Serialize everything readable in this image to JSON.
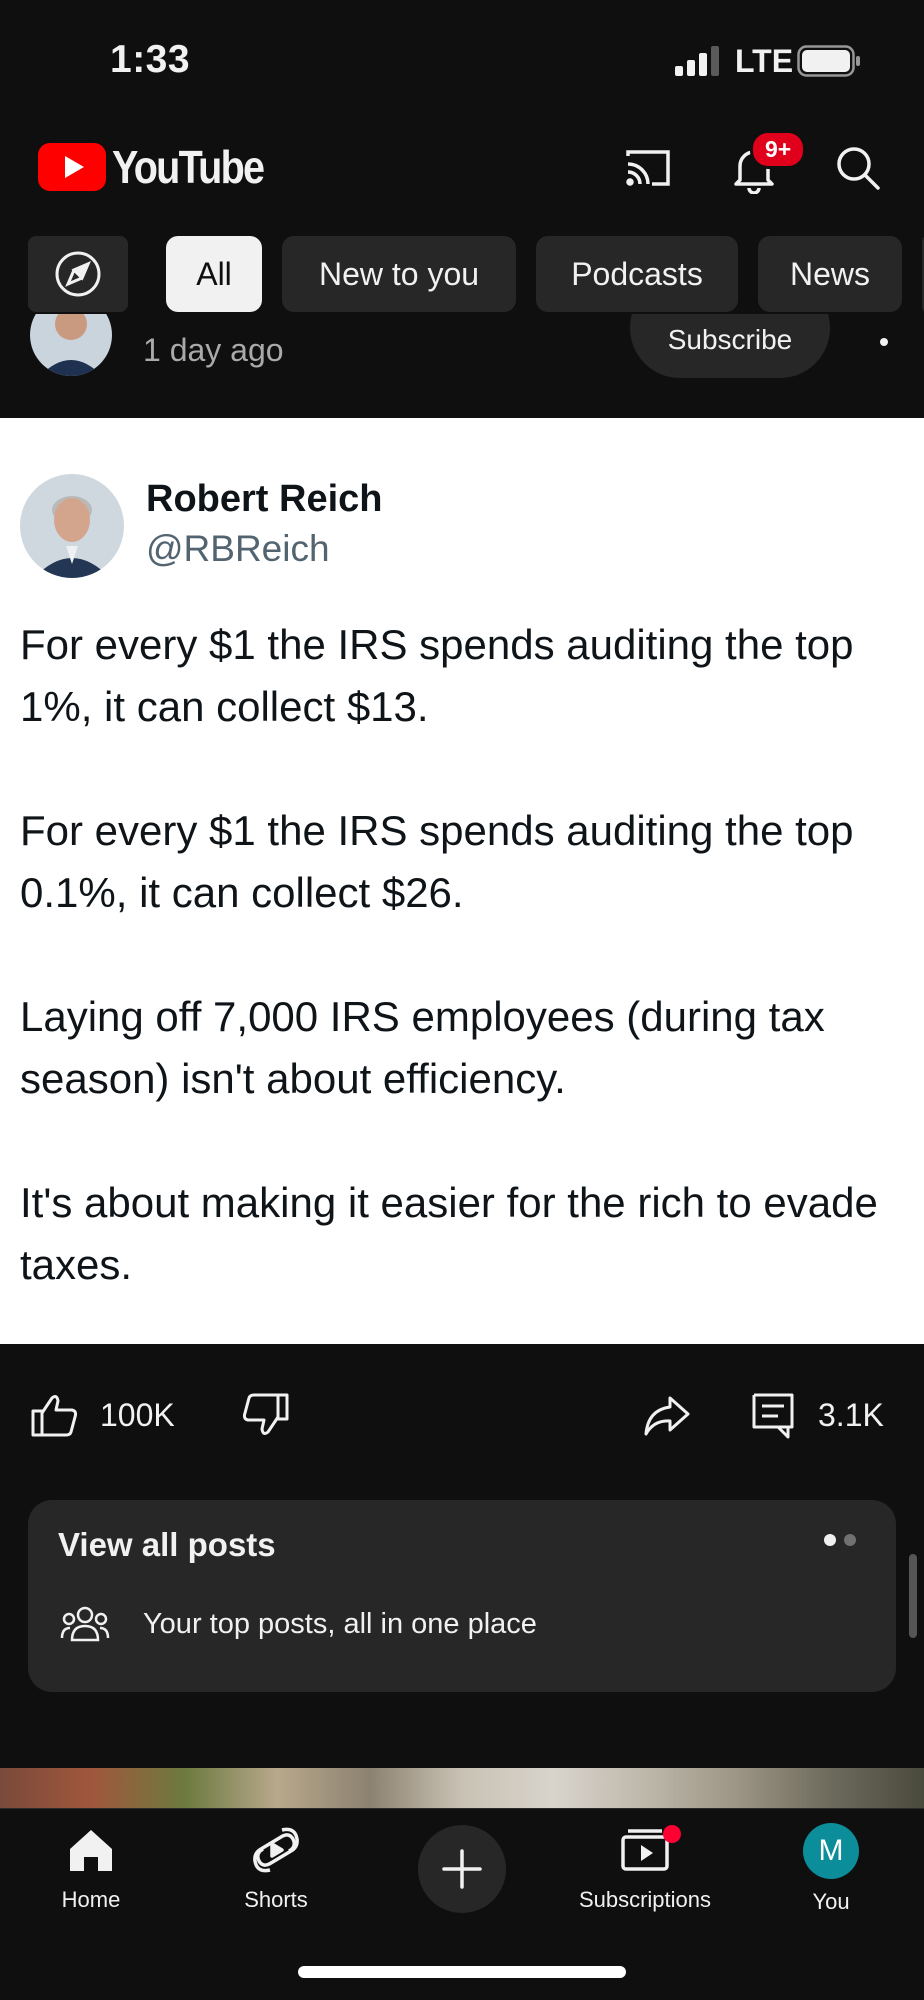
{
  "status_bar": {
    "time": "1:33",
    "network": "LTE"
  },
  "header": {
    "brand": "YouTube",
    "notification_count": "9+"
  },
  "chips": [
    {
      "label": "All",
      "selected": true
    },
    {
      "label": "New to you",
      "selected": false
    },
    {
      "label": "Podcasts",
      "selected": false
    },
    {
      "label": "News",
      "selected": false
    }
  ],
  "post": {
    "age": "1 day ago",
    "subscribe_label": "Subscribe",
    "image_tweet": {
      "name": "Robert Reich",
      "handle": "@RBReich",
      "paragraphs": [
        "For every $1 the IRS spends auditing the top 1%, it can collect $13.",
        "For every $1 the IRS spends auditing the top 0.1%, it can collect $26.",
        "Laying off 7,000 IRS employees (during tax season) isn't about efficiency.",
        "It's about making it easier for the rich to evade taxes."
      ]
    },
    "likes": "100K",
    "comments": "3.1K"
  },
  "posts_card": {
    "title": "View all posts",
    "subtitle": "Your top posts, all in one place"
  },
  "bottom_nav": {
    "home": "Home",
    "shorts": "Shorts",
    "subscriptions": "Subscriptions",
    "you": "You",
    "avatar_initial": "M"
  },
  "colors": {
    "background": "#0f0f0f",
    "brand_red": "#ff0000",
    "badge_red": "#e0001b",
    "chip_bg": "#272727",
    "avatar_teal": "#0b8e9a"
  }
}
